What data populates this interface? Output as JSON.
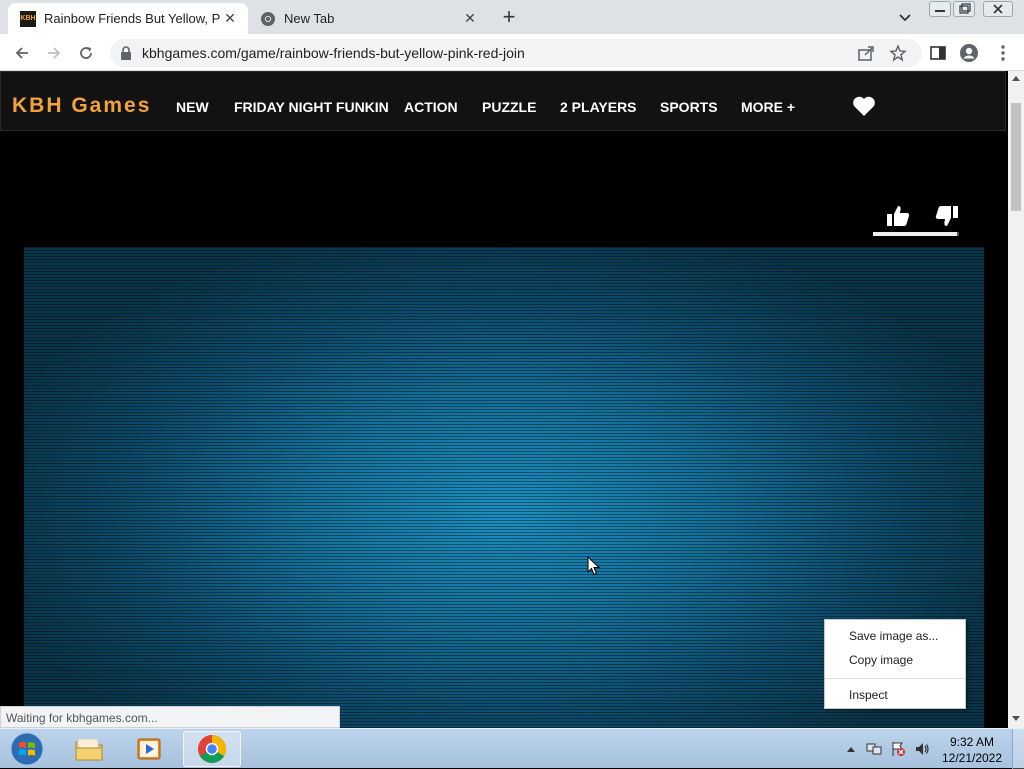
{
  "browser": {
    "tabs": [
      {
        "title": "Rainbow Friends But Yellow, Pink",
        "favicon": "KBH",
        "active": true
      },
      {
        "title": "New Tab",
        "favicon": "chrome-icon",
        "active": false
      }
    ],
    "url": "kbhgames.com/game/rainbow-friends-but-yellow-pink-red-join",
    "status_text": "Waiting for kbhgames.com..."
  },
  "site": {
    "logo": "KBH Games",
    "nav": [
      "NEW",
      "FRIDAY NIGHT FUNKIN",
      "ACTION",
      "PUZZLE",
      "2 PLAYERS",
      "SPORTS",
      "MORE +"
    ],
    "rating_fill": 0.98
  },
  "context_menu": {
    "items": [
      "Save image as...",
      "Copy image",
      "Inspect"
    ]
  },
  "taskbar": {
    "time": "9:32 AM",
    "date": "12/21/2022"
  },
  "colors": {
    "logo": "#f2a33a",
    "game_center": "#1a8fc0",
    "game_edge": "#093549"
  }
}
